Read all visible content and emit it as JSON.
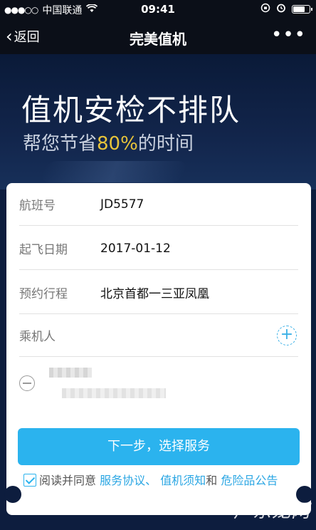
{
  "status_bar": {
    "signal": "●●●○○",
    "carrier": "中国联通",
    "wifi_icon": "wifi-icon",
    "time": "09:41",
    "battery_level": 0.8
  },
  "nav": {
    "back_label": "返回",
    "title": "完美值机",
    "more_label": "•••"
  },
  "hero": {
    "headline": "值机安检不排队",
    "sub_prefix": "帮您节省",
    "sub_highlight": "80%",
    "sub_suffix": "的时间"
  },
  "form": {
    "flight_label": "航班号",
    "flight_value": "JD5577",
    "date_label": "起飞日期",
    "date_value": "2017-01-12",
    "route_label": "预约行程",
    "route_value": "北京首都一三亚凤凰",
    "passenger_label": "乘机人",
    "add_icon": "+"
  },
  "actions": {
    "next_label": "下一步，选择服务"
  },
  "agreement": {
    "prefix": "阅读并同意",
    "link1": "服务协议、",
    "link2": "值机须知",
    "and": "和",
    "link3": "危险品公告"
  },
  "watermark": "广东龙网"
}
